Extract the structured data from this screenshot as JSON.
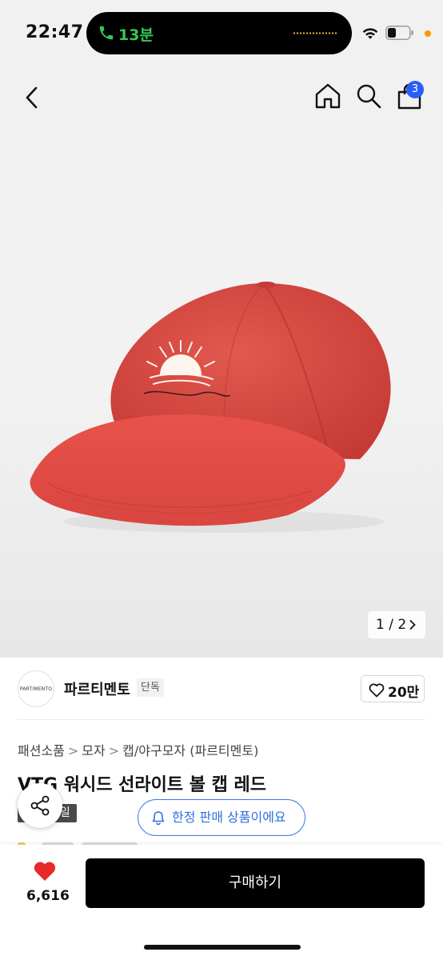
{
  "status_bar": {
    "time": "22:47",
    "call_duration": "13분",
    "accent_green": "#34c759",
    "icons": [
      "phone-icon",
      "wifi-icon",
      "battery-icon"
    ]
  },
  "top_nav": {
    "icons": [
      "chevron-left-icon",
      "home-icon",
      "search-icon",
      "shopping-bag-icon"
    ],
    "cart_count": "3",
    "badge_color": "#2a5df5"
  },
  "gallery": {
    "page_indicator": "1 / 2",
    "product_image": "red-cap-image"
  },
  "brand": {
    "logo_text": "PARTIMENTO",
    "name": "파르티멘토",
    "badge": "단독",
    "like_count": "20만"
  },
  "breadcrumb": {
    "items": [
      "패션소품",
      "모자",
      "캡/야구모자 (파르티멘토)"
    ]
  },
  "product": {
    "title": "VTG 워시드 선라이트 볼 캡 레드",
    "sale_badge": "세일",
    "limited_notice": "한정 판매 상품이에요"
  },
  "bottom_bar": {
    "favorite_count": "6,616",
    "buy_label": "구매하기",
    "heart_color": "#e8282b"
  }
}
